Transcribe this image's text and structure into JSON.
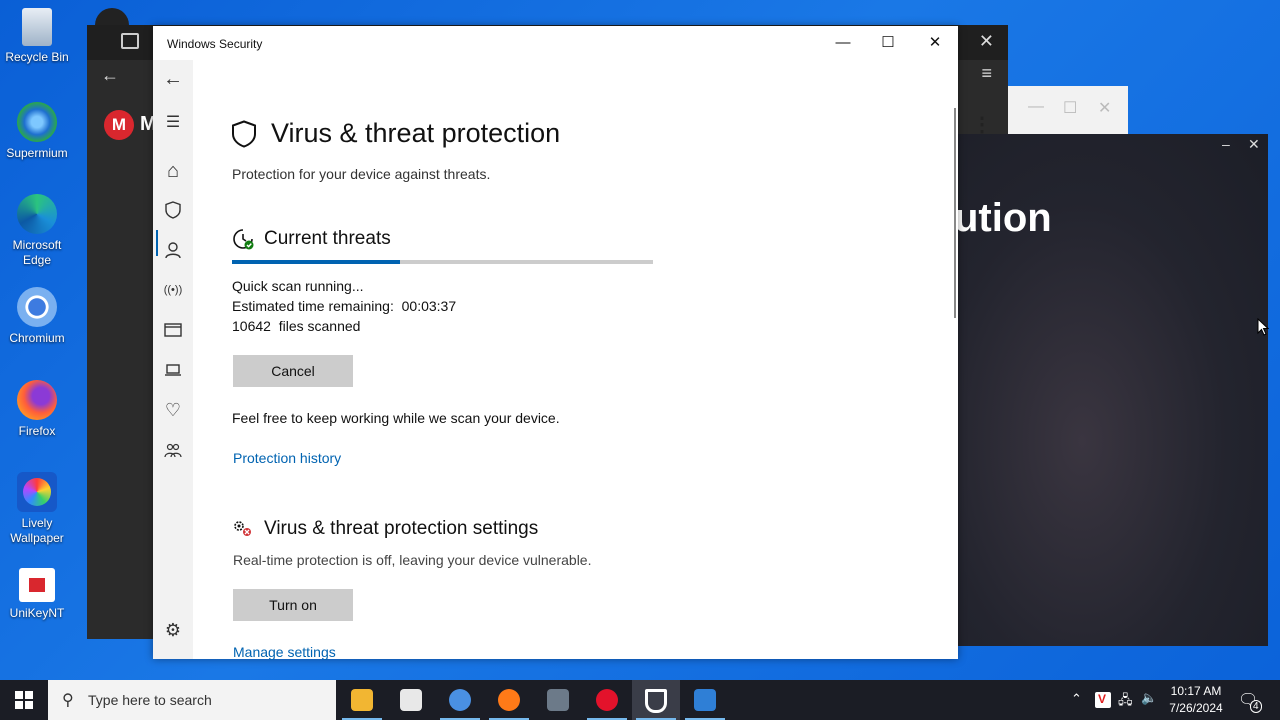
{
  "desktop": {
    "icons": [
      {
        "label": "Recycle Bin"
      },
      {
        "label": "Supermium"
      },
      {
        "label": "Microsoft Edge"
      },
      {
        "label": "Chromium"
      },
      {
        "label": "Firefox"
      },
      {
        "label": "Lively Wallpaper"
      },
      {
        "label": "UniKeyNT"
      }
    ]
  },
  "background_window": {
    "heading_fragment": "ution"
  },
  "window": {
    "title": "Windows Security",
    "controls": {
      "minimize": "—",
      "maximize": "☐",
      "close": "✕"
    }
  },
  "sidebar": {
    "items": [
      {
        "name": "back",
        "icon": "back-arrow-icon",
        "glyph": "←"
      },
      {
        "name": "menu",
        "icon": "hamburger-icon",
        "glyph": "☰"
      },
      {
        "name": "home",
        "icon": "home-icon",
        "glyph": "⌂"
      },
      {
        "name": "virus",
        "icon": "shield-icon",
        "glyph": "⛉"
      },
      {
        "name": "account",
        "icon": "person-icon",
        "glyph": "⚇"
      },
      {
        "name": "firewall",
        "icon": "wifi-antenna-icon",
        "glyph": "((•))"
      },
      {
        "name": "app-browser",
        "icon": "browser-icon",
        "glyph": "▭"
      },
      {
        "name": "device-security",
        "icon": "laptop-icon",
        "glyph": "⌨"
      },
      {
        "name": "device-health",
        "icon": "heart-icon",
        "glyph": "♡"
      },
      {
        "name": "family",
        "icon": "family-icon",
        "glyph": "⚭"
      },
      {
        "name": "settings",
        "icon": "gear-icon",
        "glyph": "⚙"
      }
    ],
    "active": "virus"
  },
  "main": {
    "title": "Virus & threat protection",
    "subtitle": "Protection for your device against threats.",
    "current_threats": {
      "heading": "Current threats",
      "progress_fraction": 0.4,
      "status": "Quick scan running...",
      "time_remaining": "Estimated time remaining:  00:03:37",
      "files_scanned": "10642  files scanned",
      "cancel_label": "Cancel",
      "info": "Feel free to keep working while we scan your device.",
      "history_link": "Protection history"
    },
    "settings": {
      "heading": "Virus & threat protection settings",
      "warning": "Real-time protection is off, leaving your device vulnerable.",
      "turn_on_label": "Turn on",
      "manage_link": "Manage settings"
    }
  },
  "taskbar": {
    "search_placeholder": "Type here to search",
    "apps": [
      {
        "name": "file-explorer",
        "color": "#f2b632"
      },
      {
        "name": "microsoft-store",
        "color": "#e8e8e8"
      },
      {
        "name": "chromium",
        "color": "#4a90e2"
      },
      {
        "name": "firefox",
        "color": "#ff7a18"
      },
      {
        "name": "app-unknown",
        "color": "#6c7a89"
      },
      {
        "name": "opera",
        "color": "#e3122b"
      },
      {
        "name": "windows-security",
        "color": "#ffffff"
      },
      {
        "name": "remote-desktop",
        "color": "#2f7fd6"
      }
    ],
    "time": "10:17 AM",
    "date": "7/26/2024",
    "notification_count": "4"
  }
}
